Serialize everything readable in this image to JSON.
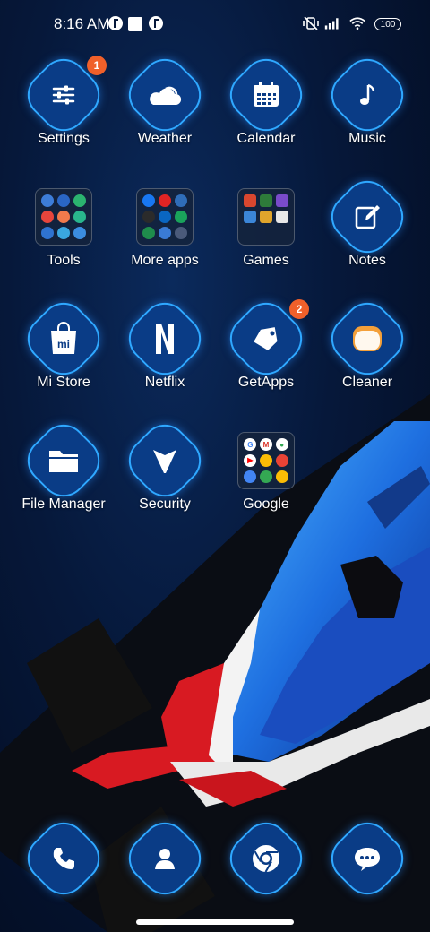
{
  "status_bar": {
    "time": "8:16 AM",
    "battery": "100"
  },
  "apps": [
    {
      "label": "Settings",
      "badge": "1",
      "icon": "sliders-icon"
    },
    {
      "label": "Weather",
      "icon": "cloud-sun-icon"
    },
    {
      "label": "Calendar",
      "icon": "calendar-icon"
    },
    {
      "label": "Music",
      "icon": "music-note-icon"
    },
    {
      "label": "Tools",
      "icon": "folder-icon"
    },
    {
      "label": "More apps",
      "icon": "folder-icon"
    },
    {
      "label": "Games",
      "icon": "folder-icon"
    },
    {
      "label": "Notes",
      "icon": "notes-pen-icon"
    },
    {
      "label": "Mi Store",
      "icon": "shopping-bag-icon"
    },
    {
      "label": "Netflix",
      "icon": "netflix-n-icon"
    },
    {
      "label": "GetApps",
      "badge": "2",
      "icon": "tag-icon"
    },
    {
      "label": "Cleaner",
      "icon": "cleaner-icon"
    },
    {
      "label": "File Manager",
      "icon": "folder-file-icon"
    },
    {
      "label": "Security",
      "icon": "security-shield-icon"
    },
    {
      "label": "Google",
      "icon": "folder-icon"
    }
  ],
  "dock": [
    {
      "name": "Phone",
      "icon": "phone-icon"
    },
    {
      "name": "Contacts",
      "icon": "contact-person-icon"
    },
    {
      "name": "Chrome",
      "icon": "chrome-icon"
    },
    {
      "name": "Messaging",
      "icon": "chat-bubble-icon"
    }
  ],
  "mi_store_mark": "mi",
  "colors": {
    "icon_bg": "#0a3c86",
    "icon_glow": "#2fa8ff",
    "badge": "#f0602a"
  }
}
